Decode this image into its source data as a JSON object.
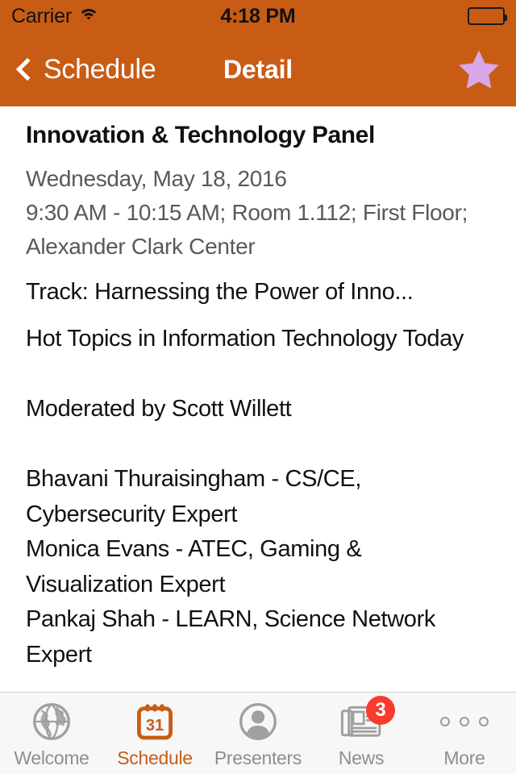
{
  "status_bar": {
    "carrier": "Carrier",
    "wifi_icon": "wifi-icon",
    "time": "4:18 PM",
    "battery_icon": "battery-full-icon"
  },
  "nav_bar": {
    "back_label": "Schedule",
    "back_icon": "chevron-left-icon",
    "title": "Detail",
    "favorite_icon": "star-icon",
    "favorite_active": true,
    "background_color": "#C85C15",
    "star_color": "#D7A7E8"
  },
  "detail": {
    "event_title": "Innovation & Technology Panel",
    "date": "Wednesday, May 18, 2016",
    "location": "9:30 AM - 10:15 AM; Room 1.112; First Floor; Alexander Clark Center",
    "track": "Track: Harnessing the Power of Inno...",
    "description": "Hot Topics in Information Technology Today\n\nModerated by Scott Willett\n\nBhavani Thuraisingham - CS/CE, Cybersecurity Expert\nMonica Evans - ATEC, Gaming & Visualization Expert\nPankaj Shah - LEARN, Science Network Expert",
    "meta_text_color": "#595959",
    "body_text_color": "#111111"
  },
  "tab_bar": {
    "active_color": "#C85C15",
    "inactive_color": "#8E8E8E",
    "badge_color": "#F93A2F",
    "items": [
      {
        "label": "Welcome",
        "icon": "globe-icon",
        "active": false,
        "badge": ""
      },
      {
        "label": "Schedule",
        "icon": "calendar-icon",
        "active": true,
        "badge": "",
        "calendar_day": "31"
      },
      {
        "label": "Presenters",
        "icon": "person-icon",
        "active": false,
        "badge": ""
      },
      {
        "label": "News",
        "icon": "newspaper-icon",
        "active": false,
        "badge": "3"
      },
      {
        "label": "More",
        "icon": "ellipsis-icon",
        "active": false,
        "badge": ""
      }
    ]
  }
}
